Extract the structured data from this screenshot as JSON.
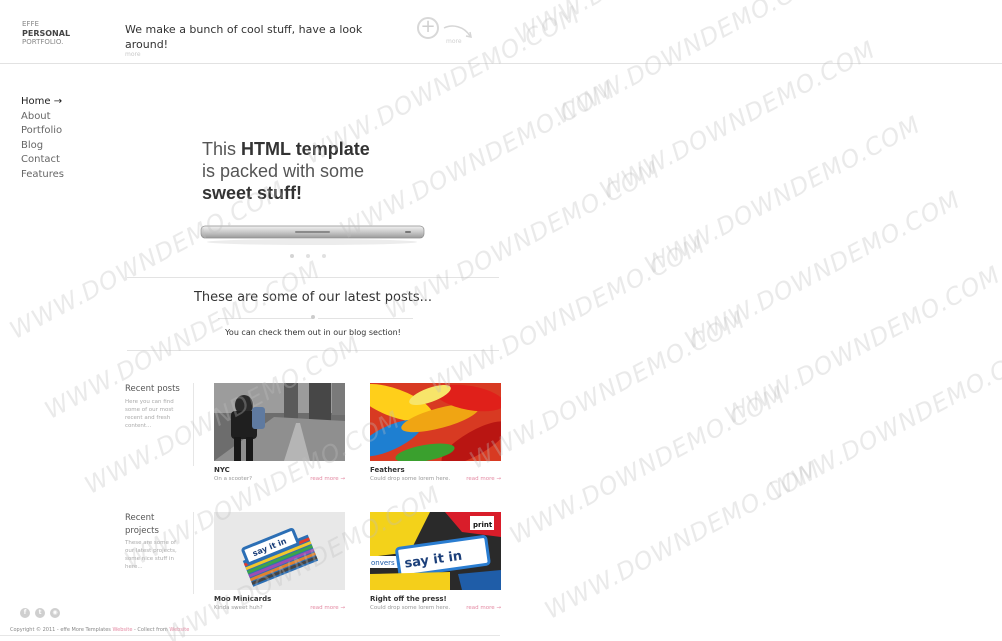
{
  "header": {
    "logo_lines": [
      "EFFE",
      "PERSONAL",
      "PORTFOLIO."
    ],
    "tagline": "We make a bunch of cool stuff, have a look around!",
    "tagline_more": "more",
    "plus_label": "more",
    "plus_icon": "plus-circle-icon"
  },
  "nav": {
    "items": [
      {
        "label": "Home →",
        "active": true
      },
      {
        "label": "About"
      },
      {
        "label": "Portfolio"
      },
      {
        "label": "Blog"
      },
      {
        "label": "Contact"
      },
      {
        "label": "Features"
      }
    ]
  },
  "hero": {
    "line1_pre": "This",
    "line1_bold": "HTML template",
    "line2": "is packed with some",
    "line3_bold": "sweet stuff!"
  },
  "posts": {
    "heading": "These are some of our latest posts...",
    "sub": "You can check them out in our blog section!"
  },
  "sections": {
    "recent_posts": {
      "title": "Recent posts",
      "desc": "Here you can find some of our most recent and fresh content...",
      "cards": [
        {
          "title": "NYC",
          "desc": "On a scooter?",
          "more": "read more →"
        },
        {
          "title": "Feathers",
          "desc": "Could drop some lorem here.",
          "more": "read more →"
        }
      ]
    },
    "recent_projects": {
      "title": "Recent projects",
      "desc": "These are some of our latest projects, some nice stuff in here...",
      "cards": [
        {
          "title": "Moo Minicards",
          "desc": "Kinda sweet huh?",
          "more": "read more →"
        },
        {
          "title": "Right off the press!",
          "desc": "Could drop some lorem here.",
          "more": "read more →"
        }
      ]
    }
  },
  "thumb_text": {
    "moo_card": "say it in",
    "print_card_a": "say it in",
    "print_card_b": "print",
    "print_card_c": "onvers"
  },
  "social": [
    {
      "name": "facebook",
      "glyph": "f"
    },
    {
      "name": "twitter",
      "glyph": "t"
    },
    {
      "name": "rss",
      "glyph": "◉"
    }
  ],
  "footer": {
    "text": "Copyright © 2011 - effe More Templates",
    "link1": "Website",
    "middle": " - Collect from",
    "link2": "Website"
  },
  "watermark": "WWW.DOWNDEMO.COM",
  "colors": {
    "accent_link": "#e48aa3",
    "text": "#444444",
    "divider": "#e3e3e3"
  }
}
